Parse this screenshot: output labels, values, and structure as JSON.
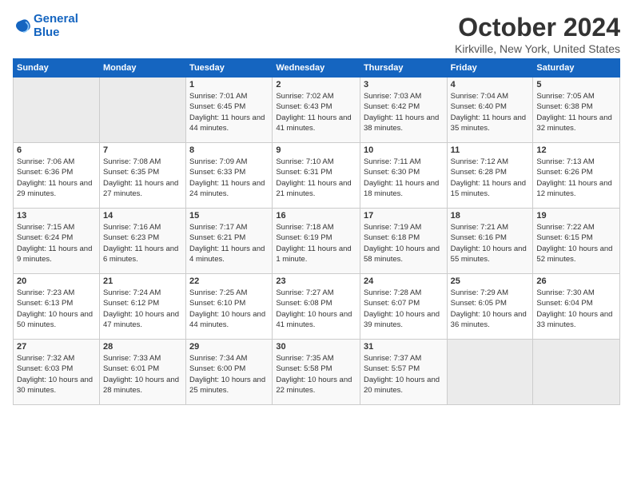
{
  "logo": {
    "line1": "General",
    "line2": "Blue"
  },
  "title": "October 2024",
  "location": "Kirkville, New York, United States",
  "weekdays": [
    "Sunday",
    "Monday",
    "Tuesday",
    "Wednesday",
    "Thursday",
    "Friday",
    "Saturday"
  ],
  "weeks": [
    [
      {
        "day": "",
        "sunrise": "",
        "sunset": "",
        "daylight": ""
      },
      {
        "day": "",
        "sunrise": "",
        "sunset": "",
        "daylight": ""
      },
      {
        "day": "1",
        "sunrise": "Sunrise: 7:01 AM",
        "sunset": "Sunset: 6:45 PM",
        "daylight": "Daylight: 11 hours and 44 minutes."
      },
      {
        "day": "2",
        "sunrise": "Sunrise: 7:02 AM",
        "sunset": "Sunset: 6:43 PM",
        "daylight": "Daylight: 11 hours and 41 minutes."
      },
      {
        "day": "3",
        "sunrise": "Sunrise: 7:03 AM",
        "sunset": "Sunset: 6:42 PM",
        "daylight": "Daylight: 11 hours and 38 minutes."
      },
      {
        "day": "4",
        "sunrise": "Sunrise: 7:04 AM",
        "sunset": "Sunset: 6:40 PM",
        "daylight": "Daylight: 11 hours and 35 minutes."
      },
      {
        "day": "5",
        "sunrise": "Sunrise: 7:05 AM",
        "sunset": "Sunset: 6:38 PM",
        "daylight": "Daylight: 11 hours and 32 minutes."
      }
    ],
    [
      {
        "day": "6",
        "sunrise": "Sunrise: 7:06 AM",
        "sunset": "Sunset: 6:36 PM",
        "daylight": "Daylight: 11 hours and 29 minutes."
      },
      {
        "day": "7",
        "sunrise": "Sunrise: 7:08 AM",
        "sunset": "Sunset: 6:35 PM",
        "daylight": "Daylight: 11 hours and 27 minutes."
      },
      {
        "day": "8",
        "sunrise": "Sunrise: 7:09 AM",
        "sunset": "Sunset: 6:33 PM",
        "daylight": "Daylight: 11 hours and 24 minutes."
      },
      {
        "day": "9",
        "sunrise": "Sunrise: 7:10 AM",
        "sunset": "Sunset: 6:31 PM",
        "daylight": "Daylight: 11 hours and 21 minutes."
      },
      {
        "day": "10",
        "sunrise": "Sunrise: 7:11 AM",
        "sunset": "Sunset: 6:30 PM",
        "daylight": "Daylight: 11 hours and 18 minutes."
      },
      {
        "day": "11",
        "sunrise": "Sunrise: 7:12 AM",
        "sunset": "Sunset: 6:28 PM",
        "daylight": "Daylight: 11 hours and 15 minutes."
      },
      {
        "day": "12",
        "sunrise": "Sunrise: 7:13 AM",
        "sunset": "Sunset: 6:26 PM",
        "daylight": "Daylight: 11 hours and 12 minutes."
      }
    ],
    [
      {
        "day": "13",
        "sunrise": "Sunrise: 7:15 AM",
        "sunset": "Sunset: 6:24 PM",
        "daylight": "Daylight: 11 hours and 9 minutes."
      },
      {
        "day": "14",
        "sunrise": "Sunrise: 7:16 AM",
        "sunset": "Sunset: 6:23 PM",
        "daylight": "Daylight: 11 hours and 6 minutes."
      },
      {
        "day": "15",
        "sunrise": "Sunrise: 7:17 AM",
        "sunset": "Sunset: 6:21 PM",
        "daylight": "Daylight: 11 hours and 4 minutes."
      },
      {
        "day": "16",
        "sunrise": "Sunrise: 7:18 AM",
        "sunset": "Sunset: 6:19 PM",
        "daylight": "Daylight: 11 hours and 1 minute."
      },
      {
        "day": "17",
        "sunrise": "Sunrise: 7:19 AM",
        "sunset": "Sunset: 6:18 PM",
        "daylight": "Daylight: 10 hours and 58 minutes."
      },
      {
        "day": "18",
        "sunrise": "Sunrise: 7:21 AM",
        "sunset": "Sunset: 6:16 PM",
        "daylight": "Daylight: 10 hours and 55 minutes."
      },
      {
        "day": "19",
        "sunrise": "Sunrise: 7:22 AM",
        "sunset": "Sunset: 6:15 PM",
        "daylight": "Daylight: 10 hours and 52 minutes."
      }
    ],
    [
      {
        "day": "20",
        "sunrise": "Sunrise: 7:23 AM",
        "sunset": "Sunset: 6:13 PM",
        "daylight": "Daylight: 10 hours and 50 minutes."
      },
      {
        "day": "21",
        "sunrise": "Sunrise: 7:24 AM",
        "sunset": "Sunset: 6:12 PM",
        "daylight": "Daylight: 10 hours and 47 minutes."
      },
      {
        "day": "22",
        "sunrise": "Sunrise: 7:25 AM",
        "sunset": "Sunset: 6:10 PM",
        "daylight": "Daylight: 10 hours and 44 minutes."
      },
      {
        "day": "23",
        "sunrise": "Sunrise: 7:27 AM",
        "sunset": "Sunset: 6:08 PM",
        "daylight": "Daylight: 10 hours and 41 minutes."
      },
      {
        "day": "24",
        "sunrise": "Sunrise: 7:28 AM",
        "sunset": "Sunset: 6:07 PM",
        "daylight": "Daylight: 10 hours and 39 minutes."
      },
      {
        "day": "25",
        "sunrise": "Sunrise: 7:29 AM",
        "sunset": "Sunset: 6:05 PM",
        "daylight": "Daylight: 10 hours and 36 minutes."
      },
      {
        "day": "26",
        "sunrise": "Sunrise: 7:30 AM",
        "sunset": "Sunset: 6:04 PM",
        "daylight": "Daylight: 10 hours and 33 minutes."
      }
    ],
    [
      {
        "day": "27",
        "sunrise": "Sunrise: 7:32 AM",
        "sunset": "Sunset: 6:03 PM",
        "daylight": "Daylight: 10 hours and 30 minutes."
      },
      {
        "day": "28",
        "sunrise": "Sunrise: 7:33 AM",
        "sunset": "Sunset: 6:01 PM",
        "daylight": "Daylight: 10 hours and 28 minutes."
      },
      {
        "day": "29",
        "sunrise": "Sunrise: 7:34 AM",
        "sunset": "Sunset: 6:00 PM",
        "daylight": "Daylight: 10 hours and 25 minutes."
      },
      {
        "day": "30",
        "sunrise": "Sunrise: 7:35 AM",
        "sunset": "Sunset: 5:58 PM",
        "daylight": "Daylight: 10 hours and 22 minutes."
      },
      {
        "day": "31",
        "sunrise": "Sunrise: 7:37 AM",
        "sunset": "Sunset: 5:57 PM",
        "daylight": "Daylight: 10 hours and 20 minutes."
      },
      {
        "day": "",
        "sunrise": "",
        "sunset": "",
        "daylight": ""
      },
      {
        "day": "",
        "sunrise": "",
        "sunset": "",
        "daylight": ""
      }
    ]
  ]
}
